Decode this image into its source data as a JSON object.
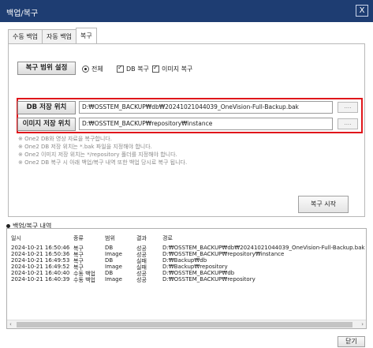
{
  "window": {
    "title": "백업/복구",
    "close_label": "X"
  },
  "tabs": [
    "수동 백업",
    "자동 백업",
    "복구"
  ],
  "restore": {
    "range_label": "복구 범위 설정",
    "options": [
      "전체",
      "DB 복구",
      "이미지 복구"
    ],
    "db_path_label": "DB 저장 위치",
    "db_path_value": "D:₩OSSTEM_BACKUP₩db₩20241021044039_OneVision-Full-Backup.bak",
    "image_path_label": "이미지 저장 위치",
    "image_path_value": "D:₩OSSTEM_BACKUP₩repository₩instance",
    "browse_label": "....",
    "notes": [
      "※ One2 DB와 영상 자료을 복구합니다.",
      "※ One2 DB 저장 위치는 *.bak 파일을 지정해야 합니다.",
      "※ One2 이미지 저장 위치는 */repository 폴더를 지정해야 합니다.",
      "※ One2 DB 복구 시 아래 백업/복구 내역 또한 백업 당시로 복구 됩니다."
    ],
    "start_button": "복구 시작"
  },
  "history": {
    "title": "백업/복구 내역",
    "columns": [
      "일시",
      "종류",
      "범위",
      "결과",
      "경로"
    ],
    "rows": [
      [
        "2024-10-21 16:50:46",
        "복구",
        "DB",
        "성공",
        "D:₩OSSTEM_BACKUP₩db₩20241021044039_OneVision-Full-Backup.bak"
      ],
      [
        "2024-10-21 16:50:36",
        "복구",
        "Image",
        "성공",
        "D:₩OSSTEM_BACKUP₩repository₩instance"
      ],
      [
        "2024-10-21 16:49:53",
        "복구",
        "DB",
        "실패",
        "D:₩Backup₩db"
      ],
      [
        "2024-10-21 16:49:52",
        "복구",
        "Image",
        "실패",
        "D:₩Backup₩repository"
      ],
      [
        "2024-10-21 16:40:40",
        "수동 백업",
        "DB",
        "성공",
        "D:₩OSSTEM_BACKUP₩db"
      ],
      [
        "2024-10-21 16:40:39",
        "수동 백업",
        "Image",
        "성공",
        "D:₩OSSTEM_BACKUP₩repository"
      ]
    ]
  },
  "footer": {
    "close_button": "닫기"
  },
  "colors": {
    "titlebar": "#1e3d72",
    "highlight_border": "#e0161b",
    "note_text": "#8a8a8a"
  }
}
